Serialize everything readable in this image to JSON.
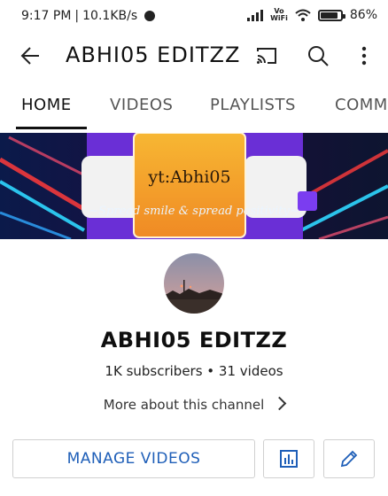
{
  "status_bar": {
    "time": "9:17 PM",
    "speed": "10.1KB/s",
    "volte_line1": "Vo",
    "volte_line2": "WiFi",
    "battery": "86%",
    "battery_level": 0.86
  },
  "app_bar": {
    "title": "ABHI05 EDITZZ",
    "icons": [
      "back-arrow-icon",
      "cast-icon",
      "search-icon",
      "more-vert-icon"
    ]
  },
  "tabs": [
    {
      "label": "HOME",
      "active": true
    },
    {
      "label": "VIDEOS",
      "active": false
    },
    {
      "label": "PLAYLISTS",
      "active": false
    },
    {
      "label": "COMMU",
      "active": false
    }
  ],
  "banner": {
    "logo_prefix": "yt:",
    "logo_name": "Abhi05",
    "tagline": "~Spread smile & spread positivity~"
  },
  "channel": {
    "name": "ABHI05 EDITZZ",
    "stats": "1K subscribers • 31 videos",
    "more_about": "More about this channel"
  },
  "actions": {
    "manage_label": "MANAGE VIDEOS",
    "analytics_icon": "analytics-icon",
    "edit_icon": "edit-pencil-icon"
  },
  "colors": {
    "accent_blue": "#1f5fb8",
    "banner_orange": "#f5a623",
    "banner_purple": "#6a2fd6"
  }
}
